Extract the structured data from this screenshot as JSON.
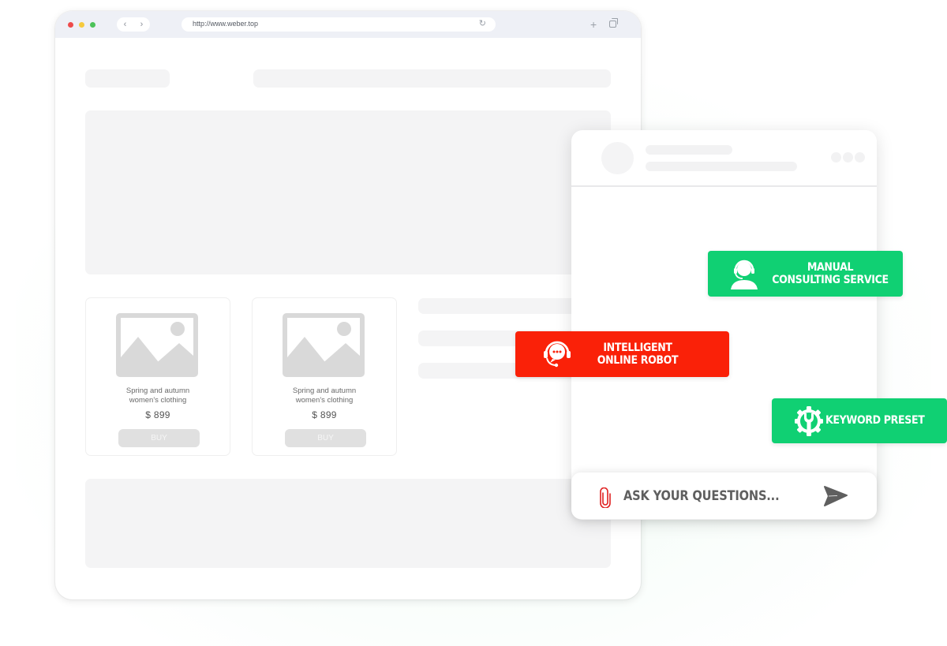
{
  "browser": {
    "url": "http://www.weber.top",
    "nav_back": "‹",
    "nav_forward": "›",
    "reload_icon": "↻",
    "new_tab_icon": "+"
  },
  "products": [
    {
      "name_line1": "Spring and autumn",
      "name_line2": "women's clothing",
      "price": "$ 899",
      "buy_label": "BUY"
    },
    {
      "name_line1": "Spring and autumn",
      "name_line2": "women's clothing",
      "price": "$ 899",
      "buy_label": "BUY"
    }
  ],
  "chat": {
    "input_placeholder": "ASK YOUR QUESTIONS..."
  },
  "badges": {
    "manual": {
      "line1": "MANUAL",
      "line2": "CONSULTING SERVICE",
      "color": "#10d073"
    },
    "robot": {
      "line1": "INTELLIGENT",
      "line2": "ONLINE ROBOT",
      "color": "#fa2108"
    },
    "keyword": {
      "label": "KEYWORD PRESET",
      "color": "#10d073"
    }
  },
  "colors": {
    "traffic_red": "#ee4b4b",
    "traffic_yellow": "#f6ca3d",
    "traffic_green": "#4cc259",
    "attach_icon": "#e02020",
    "send_icon": "#5f5f5f"
  }
}
